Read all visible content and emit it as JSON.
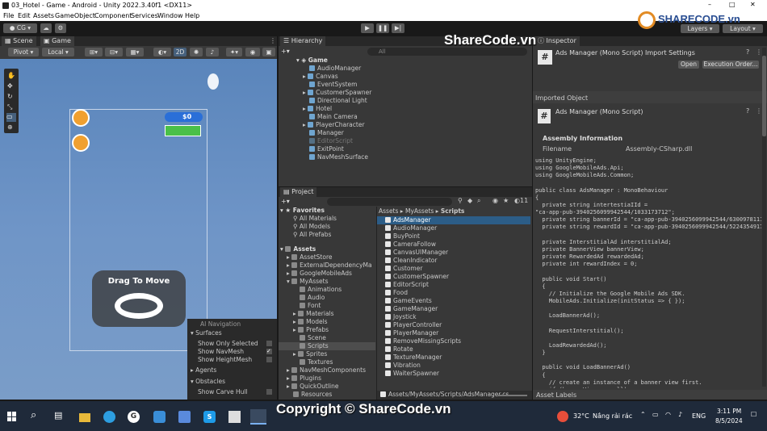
{
  "title": "03_Hotel - Game - Android - Unity 2022.3.40f1 <DX11>",
  "menu": [
    "File",
    "Edit",
    "Assets",
    "GameObject",
    "Component",
    "Services",
    "Window",
    "Help"
  ],
  "toolbar": {
    "account": "CG",
    "layers": "Layers",
    "layout": "Layout"
  },
  "scene_tabs": [
    "Scene",
    "Game"
  ],
  "scene_toolbar": {
    "pivot": "Pivot",
    "local": "Local",
    "mode_2d": "2D"
  },
  "game_view": {
    "money": "$0",
    "drag": "Drag To Move"
  },
  "ai_nav": {
    "title": "AI Navigation",
    "surfaces": "Surfaces",
    "opt1": "Show Only Selected",
    "opt2": "Show NavMesh",
    "opt3": "Show HeightMesh",
    "agents": "Agents",
    "obstacles": "Obstacles",
    "opt4": "Show Carve Hull"
  },
  "hierarchy": {
    "tab": "Hierarchy",
    "search": "All",
    "root": "Game",
    "items": [
      "AudioManager",
      "Canvas",
      "EventSystem",
      "CustomerSpawner",
      "Directional Light",
      "Hotel",
      "Main Camera",
      "PlayerCharacter",
      "Manager",
      "EditorScript",
      "ExitPoint",
      "NavMeshSurface"
    ]
  },
  "project": {
    "tab": "Project",
    "count": "11",
    "favorites": "Favorites",
    "fav_items": [
      "All Materials",
      "All Models",
      "All Prefabs"
    ],
    "assets": "Assets",
    "asset_items": [
      "AssetStore",
      "ExternalDependencyMa",
      "GoogleMobileAds",
      "MyAssets"
    ],
    "myassets_items": [
      "Animations",
      "Audio",
      "Font",
      "Materials",
      "Models",
      "Prefabs",
      "Scene",
      "Scripts",
      "Sprites",
      "Textures"
    ],
    "more_items": [
      "NavMeshComponents",
      "Plugins",
      "QuickOutline",
      "Resources"
    ],
    "breadcrumb": [
      "Assets",
      "MyAssets",
      "Scripts"
    ],
    "scripts": [
      "AdsManager",
      "AudioManager",
      "BuyPoint",
      "CameraFollow",
      "CanvasUIManager",
      "CleanIndicator",
      "Customer",
      "CustomerSpawner",
      "EditorScript",
      "Food",
      "GameEvents",
      "GameManager",
      "Joystick",
      "PlayerController",
      "PlayerManager",
      "RemoveMissingScripts",
      "Rotate",
      "TextureManager",
      "Vibration",
      "WaiterSpawner"
    ],
    "path": "Assets/MyAssets/Scripts/AdsManager.cs"
  },
  "inspector": {
    "tab": "Inspector",
    "header": "Ads Manager (Mono Script) Import Settings",
    "open": "Open",
    "exec": "Execution Order...",
    "imported": "Imported Object",
    "script_name": "Ads Manager (Mono Script)",
    "assembly": "Assembly Information",
    "filename_label": "Filename",
    "filename_value": "Assembly-CSharp.dll",
    "asset_labels": "Asset Labels",
    "code": "using UnityEngine;\nusing GoogleMobileAds.Api;\nusing GoogleMobileAds.Common;\n\npublic class AdsManager : MonoBehaviour\n{\n  private string intertestiaIId =\n\"ca-app-pub-3940256099942544/1033173712\";\n  private string bannerId = \"ca-app-pub-3940256099942544/6300978111\";\n  private string rewardId = \"ca-app-pub-3940256099942544/5224354917\";\n\n  private InterstitialAd interstitialAd;\n  private BannerView bannerView;\n  private RewardedAd rewardedAd;\n  private int rewardIndex = 0;\n\n  public void Start()\n  {\n    // Initialize the Google Mobile Ads SDK.\n    MobileAds.Initialize(initStatus => { });\n\n    LoadBannerAd();\n\n    RequestInterstitial();\n\n    LoadRewardedAd();\n  }\n\n  public void LoadBannerAd()\n  {\n    // create an instance of a banner view first.\n    if (bannerView == null)"
  },
  "watermark": {
    "top": "ShareCode.vn",
    "bottom": "Copyright © ShareCode.vn",
    "logo": "SHARECODE.vn"
  },
  "taskbar": {
    "temp": "32°C",
    "weather": "Nắng rải rác",
    "lang": "ENG",
    "time": "3:11 PM",
    "date": "8/5/2024"
  }
}
